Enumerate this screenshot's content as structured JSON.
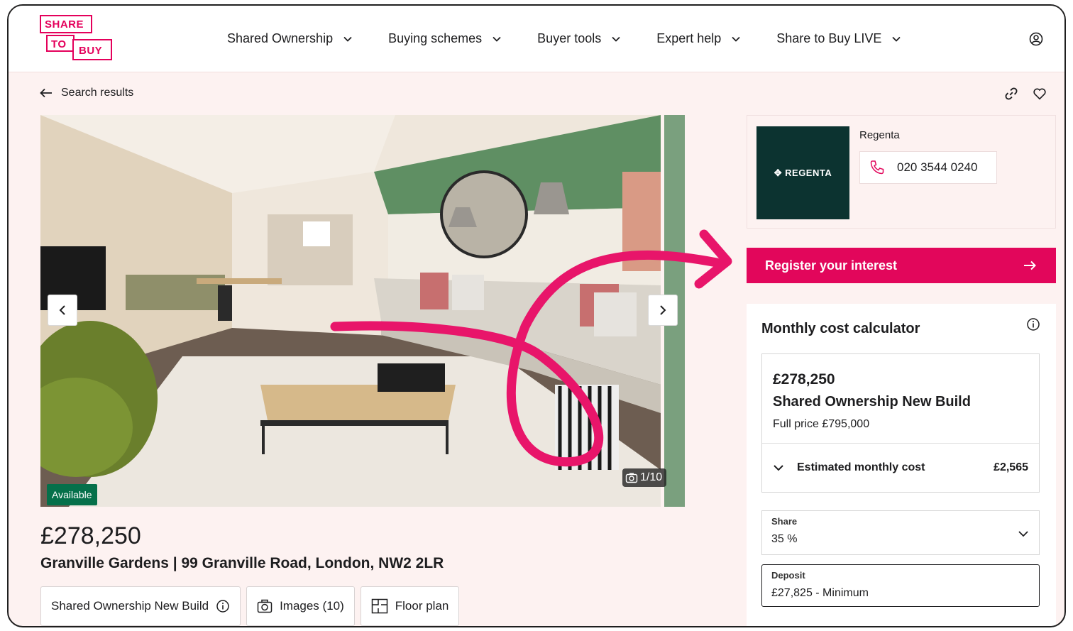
{
  "logo": {
    "line1": "SHARE",
    "line2": "TO",
    "line3": "BUY"
  },
  "nav": [
    {
      "label": "Shared Ownership"
    },
    {
      "label": "Buying schemes"
    },
    {
      "label": "Buyer tools"
    },
    {
      "label": "Expert help"
    },
    {
      "label": "Share to Buy LIVE"
    }
  ],
  "breadcrumb": {
    "back_label": "Search results"
  },
  "gallery": {
    "status_badge": "Available",
    "counter": "1/10"
  },
  "listing": {
    "price": "£278,250",
    "address": "Granville Gardens | 99 Granville Road, London, NW2 2LR",
    "chips": {
      "scheme": "Shared Ownership New Build",
      "images": "Images (10)",
      "floor_plan": "Floor plan"
    }
  },
  "agent": {
    "name": "Regenta",
    "logo_text": "REGENTA",
    "phone": "020 3544 0240"
  },
  "register": {
    "label": "Register your interest"
  },
  "calculator": {
    "title": "Monthly cost calculator",
    "summary": {
      "price": "£278,250",
      "type": "Shared Ownership New Build",
      "full_price": "Full price £795,000",
      "monthly_label": "Estimated monthly cost",
      "monthly_value": "£2,565"
    },
    "share": {
      "label": "Share",
      "value": "35 %"
    },
    "deposit": {
      "label": "Deposit",
      "value": "£27,825 - Minimum"
    }
  },
  "colors": {
    "brand": "#e2065b",
    "page_bg": "#fdf2f1",
    "available": "#05704a",
    "agent_logo_bg": "#0c3330"
  }
}
